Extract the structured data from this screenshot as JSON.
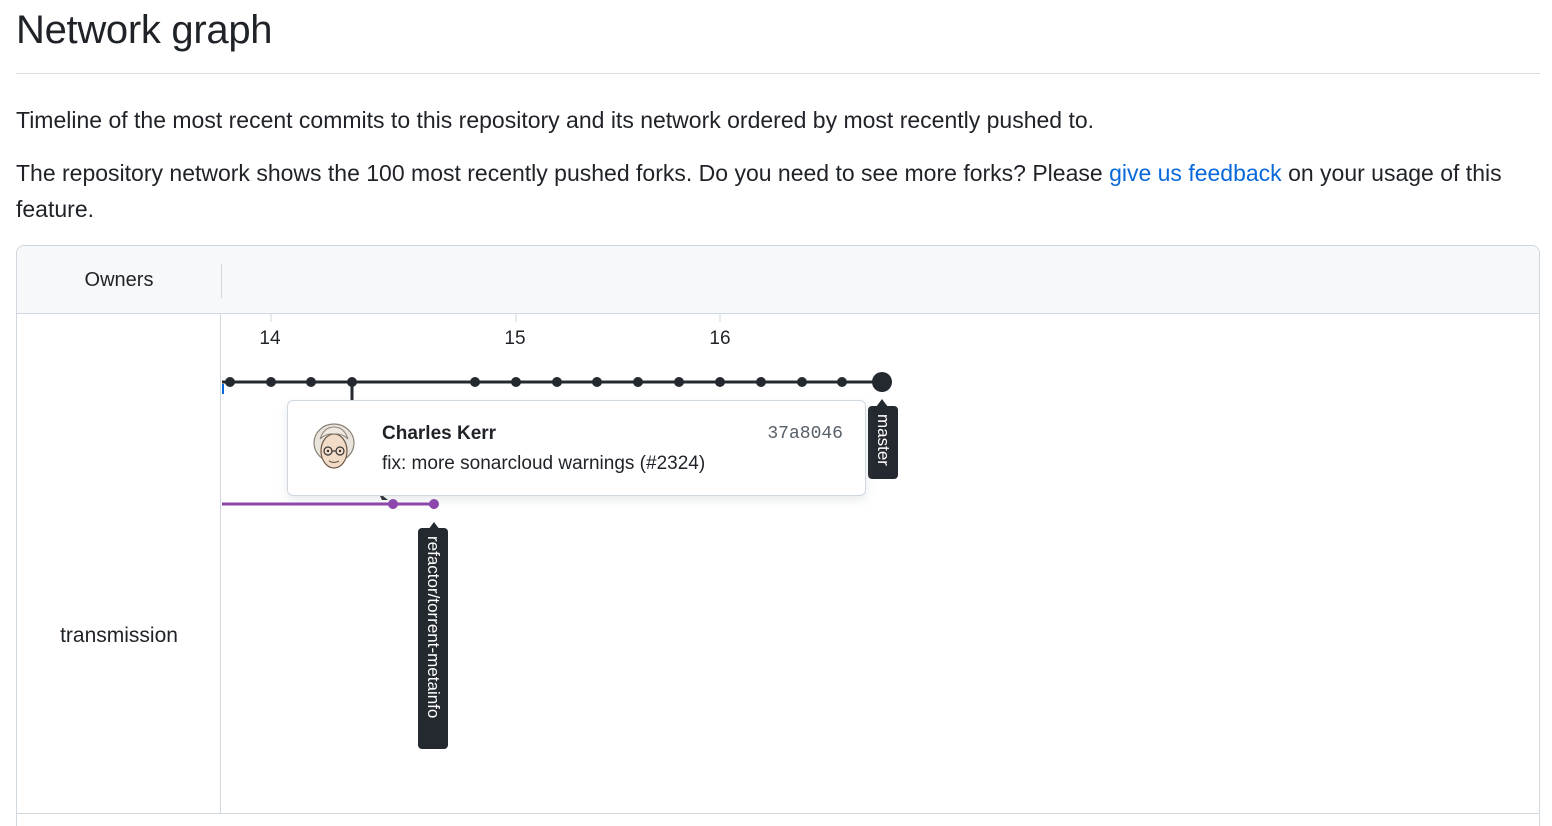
{
  "page": {
    "title": "Network graph",
    "description_1": "Timeline of the most recent commits to this repository and its network ordered by most recently pushed to.",
    "description_2_pre": "The repository network shows the 100 most recently pushed forks. Do you need to see more forks? Please ",
    "feedback_link": "give us feedback",
    "description_2_post": " on your usage of this feature."
  },
  "graph": {
    "owners_header": "Owners",
    "owner": "transmission",
    "days": [
      "14",
      "15",
      "16"
    ],
    "branches": [
      {
        "name": "master",
        "color": "#24292f"
      },
      {
        "name": "refactor/torrent-metainfo",
        "color": "#8e44ad"
      }
    ]
  },
  "popover": {
    "author": "Charles Kerr",
    "sha": "37a8046",
    "message": "fix: more sonarcloud warnings (#2324)"
  },
  "colors": {
    "link": "#0969da",
    "master_line": "#24292f",
    "branch_line": "#8e44ad",
    "tag_bg": "#24292f"
  }
}
